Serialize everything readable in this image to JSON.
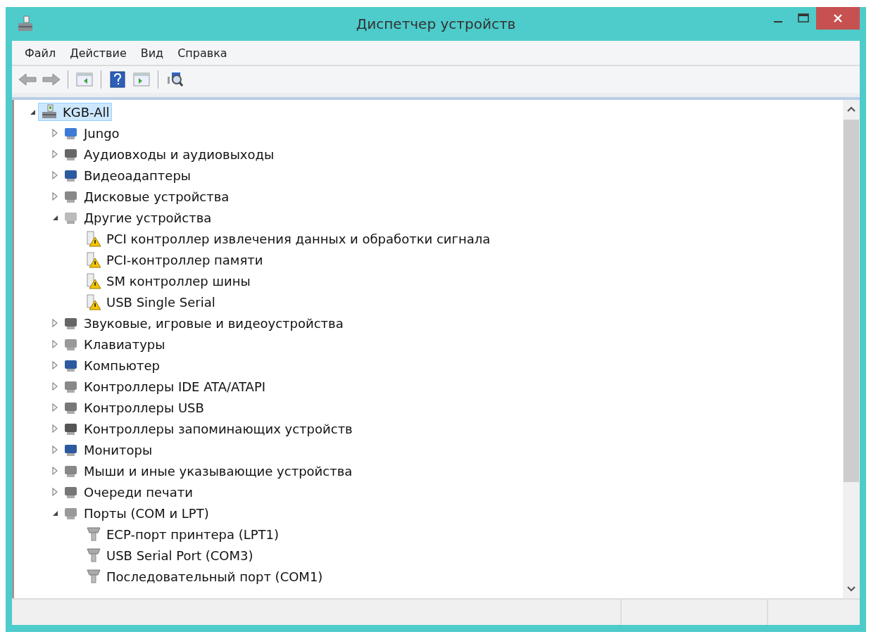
{
  "window": {
    "title": "Диспетчер устройств"
  },
  "menu": [
    "Файл",
    "Действие",
    "Вид",
    "Справка"
  ],
  "tree": {
    "label": "KGB-All",
    "selected": true,
    "expanded": true,
    "children": [
      {
        "label": "Jungo",
        "selected": false,
        "expanded": false
      },
      {
        "label": "Аудиовходы и аудиовыходы",
        "selected": false,
        "expanded": false
      },
      {
        "label": "Видеоадаптеры",
        "selected": false,
        "expanded": false
      },
      {
        "label": "Дисковые устройства",
        "selected": false,
        "expanded": false
      },
      {
        "label": "Другие устройства",
        "selected": false,
        "expanded": true,
        "children": [
          {
            "label": "PCI контроллер извлечения данных и обработки сигнала",
            "selected": false,
            "problem": true
          },
          {
            "label": "PCI-контроллер памяти",
            "selected": false,
            "problem": true
          },
          {
            "label": "SM контроллер шины",
            "selected": false,
            "problem": true
          },
          {
            "label": "USB Single Serial",
            "selected": false,
            "problem": true
          }
        ]
      },
      {
        "label": "Звуковые, игровые и видеоустройства",
        "selected": false,
        "expanded": false
      },
      {
        "label": "Клавиатуры",
        "selected": false,
        "expanded": false
      },
      {
        "label": "Компьютер",
        "selected": false,
        "expanded": false
      },
      {
        "label": "Контроллеры IDE ATA/ATAPI",
        "selected": false,
        "expanded": false
      },
      {
        "label": "Контроллеры USB",
        "selected": false,
        "expanded": false
      },
      {
        "label": "Контроллеры запоминающих устройств",
        "selected": false,
        "expanded": false
      },
      {
        "label": "Мониторы",
        "selected": false,
        "expanded": false
      },
      {
        "label": "Мыши и иные указывающие устройства",
        "selected": false,
        "expanded": false
      },
      {
        "label": "Очереди печати",
        "selected": false,
        "expanded": false
      },
      {
        "label": "Порты (COM и LPT)",
        "selected": false,
        "expanded": true,
        "children": [
          {
            "label": "ECP-порт принтера (LPT1)",
            "selected": false,
            "problem": false
          },
          {
            "label": "USB Serial Port (COM3)",
            "selected": false,
            "problem": false
          },
          {
            "label": "Последовательный порт (COM1)",
            "selected": false,
            "problem": false
          }
        ]
      }
    ]
  }
}
